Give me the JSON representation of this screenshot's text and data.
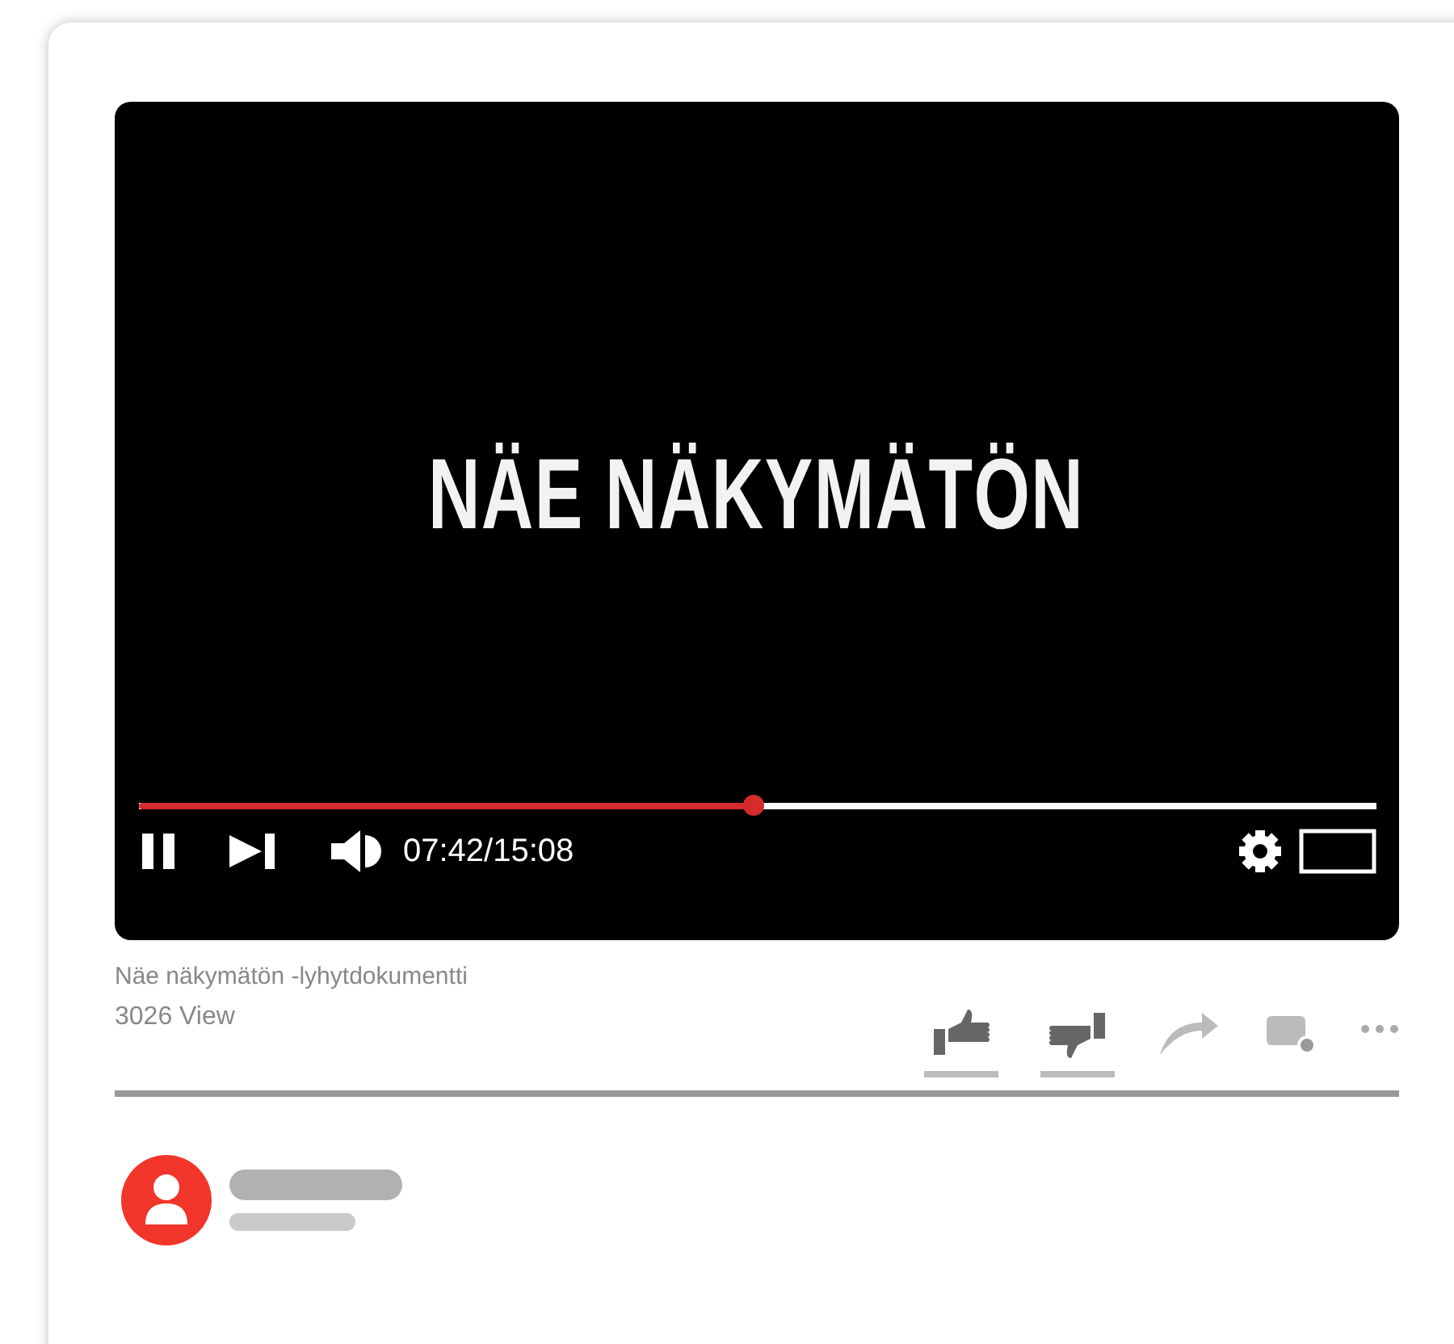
{
  "video": {
    "title_card": "NÄE NÄKYMÄTÖN",
    "progress": {
      "level": 0.497
    },
    "time": "07:42/15:08",
    "playing": true
  },
  "info": {
    "title": "Näe näkymätön -lyhytdokumentti",
    "views": "3026 View"
  },
  "actions": [
    {
      "kind": "like"
    },
    {
      "kind": "dislike"
    },
    {
      "kind": "share"
    },
    {
      "kind": "comment"
    },
    {
      "kind": "more"
    }
  ]
}
